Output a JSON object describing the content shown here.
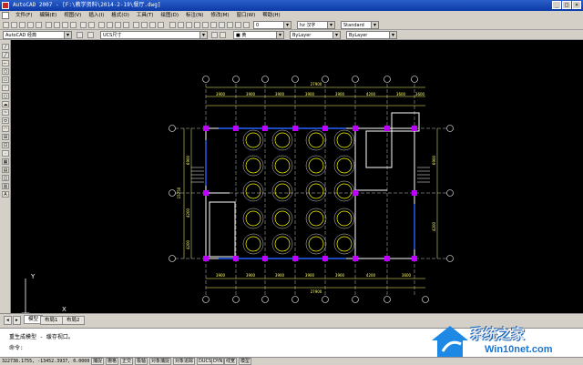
{
  "titlebar": {
    "title": "AutoCAD 2007 - [F:\\教学资料\\2014-2-19\\餐厅.dwg]",
    "min": "_",
    "max": "□",
    "close": "×"
  },
  "menu": [
    "文件(F)",
    "编辑(E)",
    "视图(V)",
    "插入(I)",
    "格式(O)",
    "工具(T)",
    "绘图(D)",
    "标注(N)",
    "修改(M)",
    "窗口(W)",
    "帮助(H)"
  ],
  "toolbar": {
    "workspace": "AutoCAD 经典",
    "layer": "0",
    "textstyle": "hz 汉字",
    "dimstyle": "Standard",
    "ucs": "UCS尺寸",
    "color": "■ 黄",
    "linetype": "ByLayer",
    "lineweight": "ByLayer"
  },
  "drawing": {
    "dims_top_total": "27900",
    "dims_bottom_total": "27900",
    "dims_top": [
      "3900",
      "3900",
      "3900",
      "3900",
      "3900",
      "4200",
      "3600",
      "3600"
    ],
    "dims_bottom": [
      "3900",
      "3900",
      "3900",
      "3900",
      "3900",
      "4200",
      "3600"
    ],
    "dims_left_total": "15250",
    "dims_left": [
      "6900",
      "4200",
      "4200"
    ],
    "dims_right": [
      "6900",
      "4200"
    ],
    "ucs_x": "X",
    "ucs_y": "Y"
  },
  "tabs": [
    "模型",
    "布局1",
    "布局2"
  ],
  "command": {
    "line1": "重生成模型 - 缓存视口。",
    "line2": "命令:"
  },
  "status": {
    "coords": "322738.1755, -13452.3937, 0.0000",
    "toggles": [
      "捕捉",
      "栅格",
      "正交",
      "极轴",
      "对象捕捉",
      "对象追踪",
      "DUCS",
      "DYN",
      "线宽",
      "模型"
    ]
  },
  "watermark": {
    "text1": "系统之家",
    "text2": "Win10net.com"
  },
  "colors": {
    "wall": "#ffffff",
    "window": "#2962ff",
    "column": "#c000ff",
    "dim": "#ffff66",
    "table": "#ffff00"
  }
}
